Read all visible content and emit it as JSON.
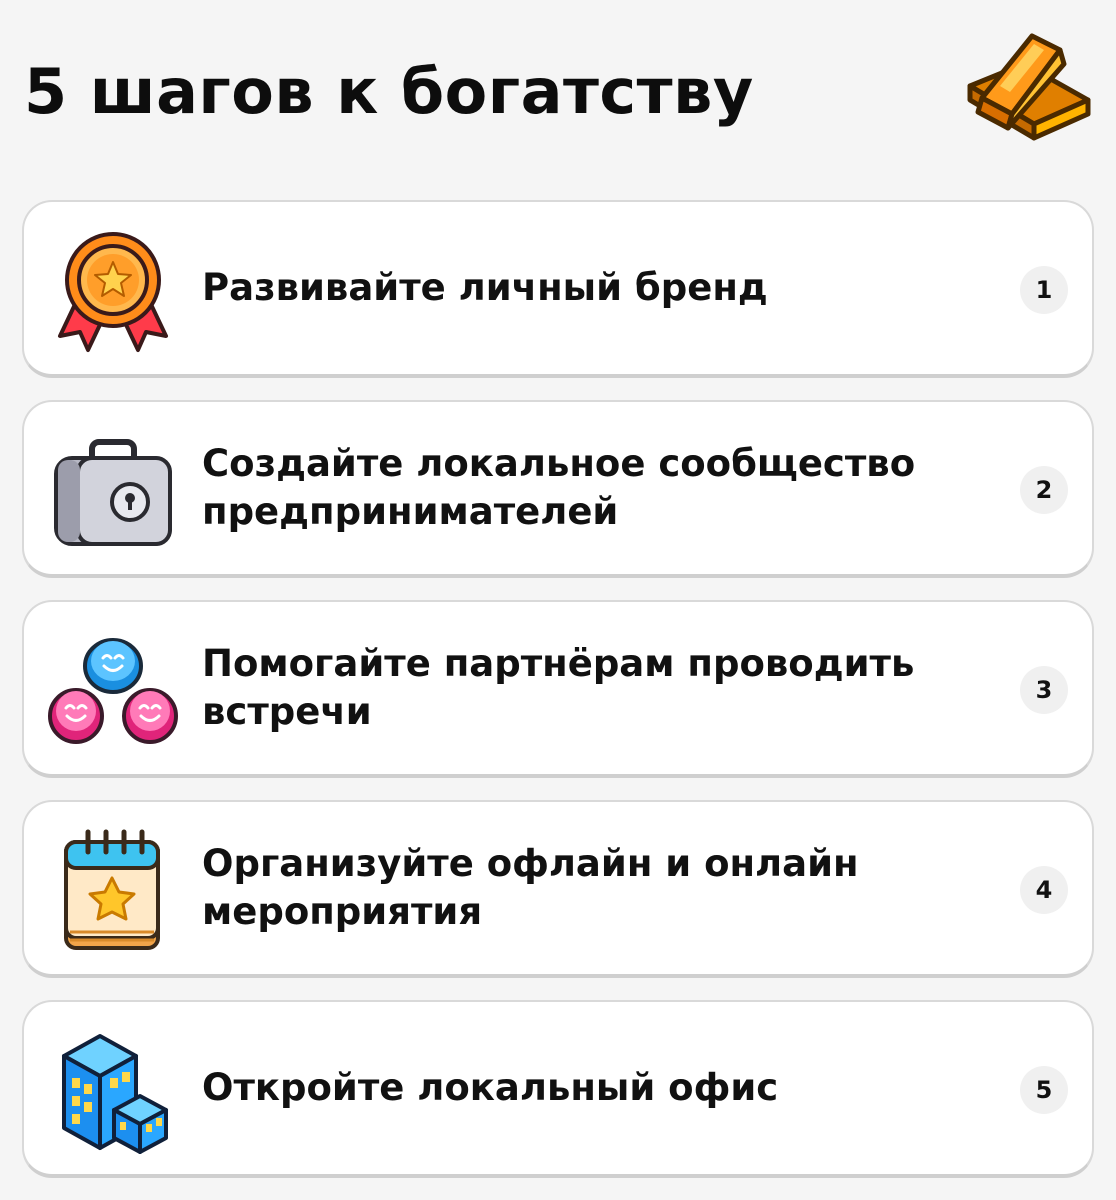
{
  "header": {
    "title": "5 шагов к богатству",
    "icon": "gold-bars-icon"
  },
  "steps": [
    {
      "label": "Развивайте личный бренд",
      "number": "1",
      "icon": "medal-icon"
    },
    {
      "label": "Создайте локальное сообщество предпринимателей",
      "number": "2",
      "icon": "briefcase-icon"
    },
    {
      "label": "Помогайте партнёрам проводить встречи",
      "number": "3",
      "icon": "people-icon"
    },
    {
      "label": "Организуйте офлайн и онлайн мероприятия",
      "number": "4",
      "icon": "calendar-star-icon"
    },
    {
      "label": "Откройте локальный офис",
      "number": "5",
      "icon": "office-building-icon"
    }
  ],
  "colors": {
    "background": "#f5f5f5",
    "card": "#ffffff",
    "card_border": "#d9d9d9",
    "badge": "#f0f0f0",
    "text": "#111111"
  }
}
